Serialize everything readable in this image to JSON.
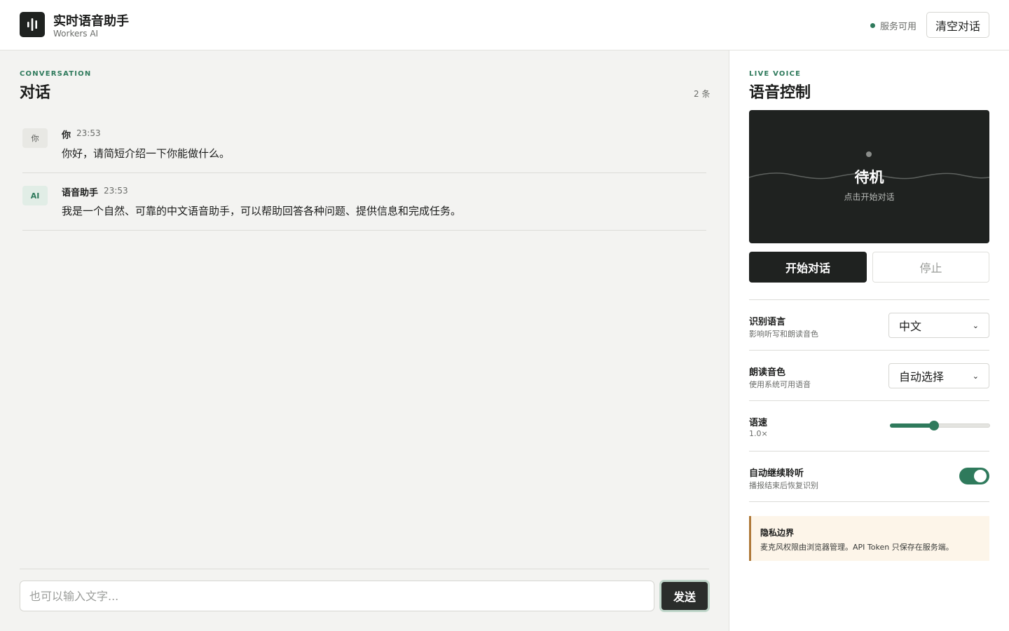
{
  "header": {
    "title": "实时语音助手",
    "subtitle": "Workers AI",
    "status_text": "服务可用",
    "clear_label": "清空对话"
  },
  "conversation": {
    "eyebrow": "CONVERSATION",
    "title": "对话",
    "count": "2 条",
    "messages": [
      {
        "avatar": "你",
        "author": "你",
        "time": "23:53",
        "text": "你好，请简短介绍一下你能做什么。"
      },
      {
        "avatar": "AI",
        "author": "语音助手",
        "time": "23:53",
        "text": "我是一个自然、可靠的中文语音助手，可以帮助回答各种问题、提供信息和完成任务。"
      }
    ],
    "input_placeholder": "也可以输入文字...",
    "send_label": "发送"
  },
  "voice": {
    "eyebrow": "LIVE VOICE",
    "title": "语音控制",
    "state": "待机",
    "hint": "点击开始对话",
    "start_label": "开始对话",
    "stop_label": "停止"
  },
  "settings": {
    "language": {
      "label": "识别语言",
      "desc": "影响听写和朗读音色",
      "value": "中文"
    },
    "voice": {
      "label": "朗读音色",
      "desc": "使用系统可用语音",
      "value": "自动选择"
    },
    "rate": {
      "label": "语速",
      "desc": "1.0×",
      "fill_fraction": 0.44
    },
    "auto_listen": {
      "label": "自动继续聆听",
      "desc": "播报结束后恢复识别",
      "enabled": true
    }
  },
  "privacy": {
    "title": "隐私边界",
    "text": "麦克风权限由浏览器管理。API Token 只保存在服务端。"
  },
  "colors": {
    "accent": "#2f7a5c",
    "dark": "#1f2220",
    "privacy_bg": "#fdf5e9",
    "privacy_border": "#b07a3a"
  }
}
